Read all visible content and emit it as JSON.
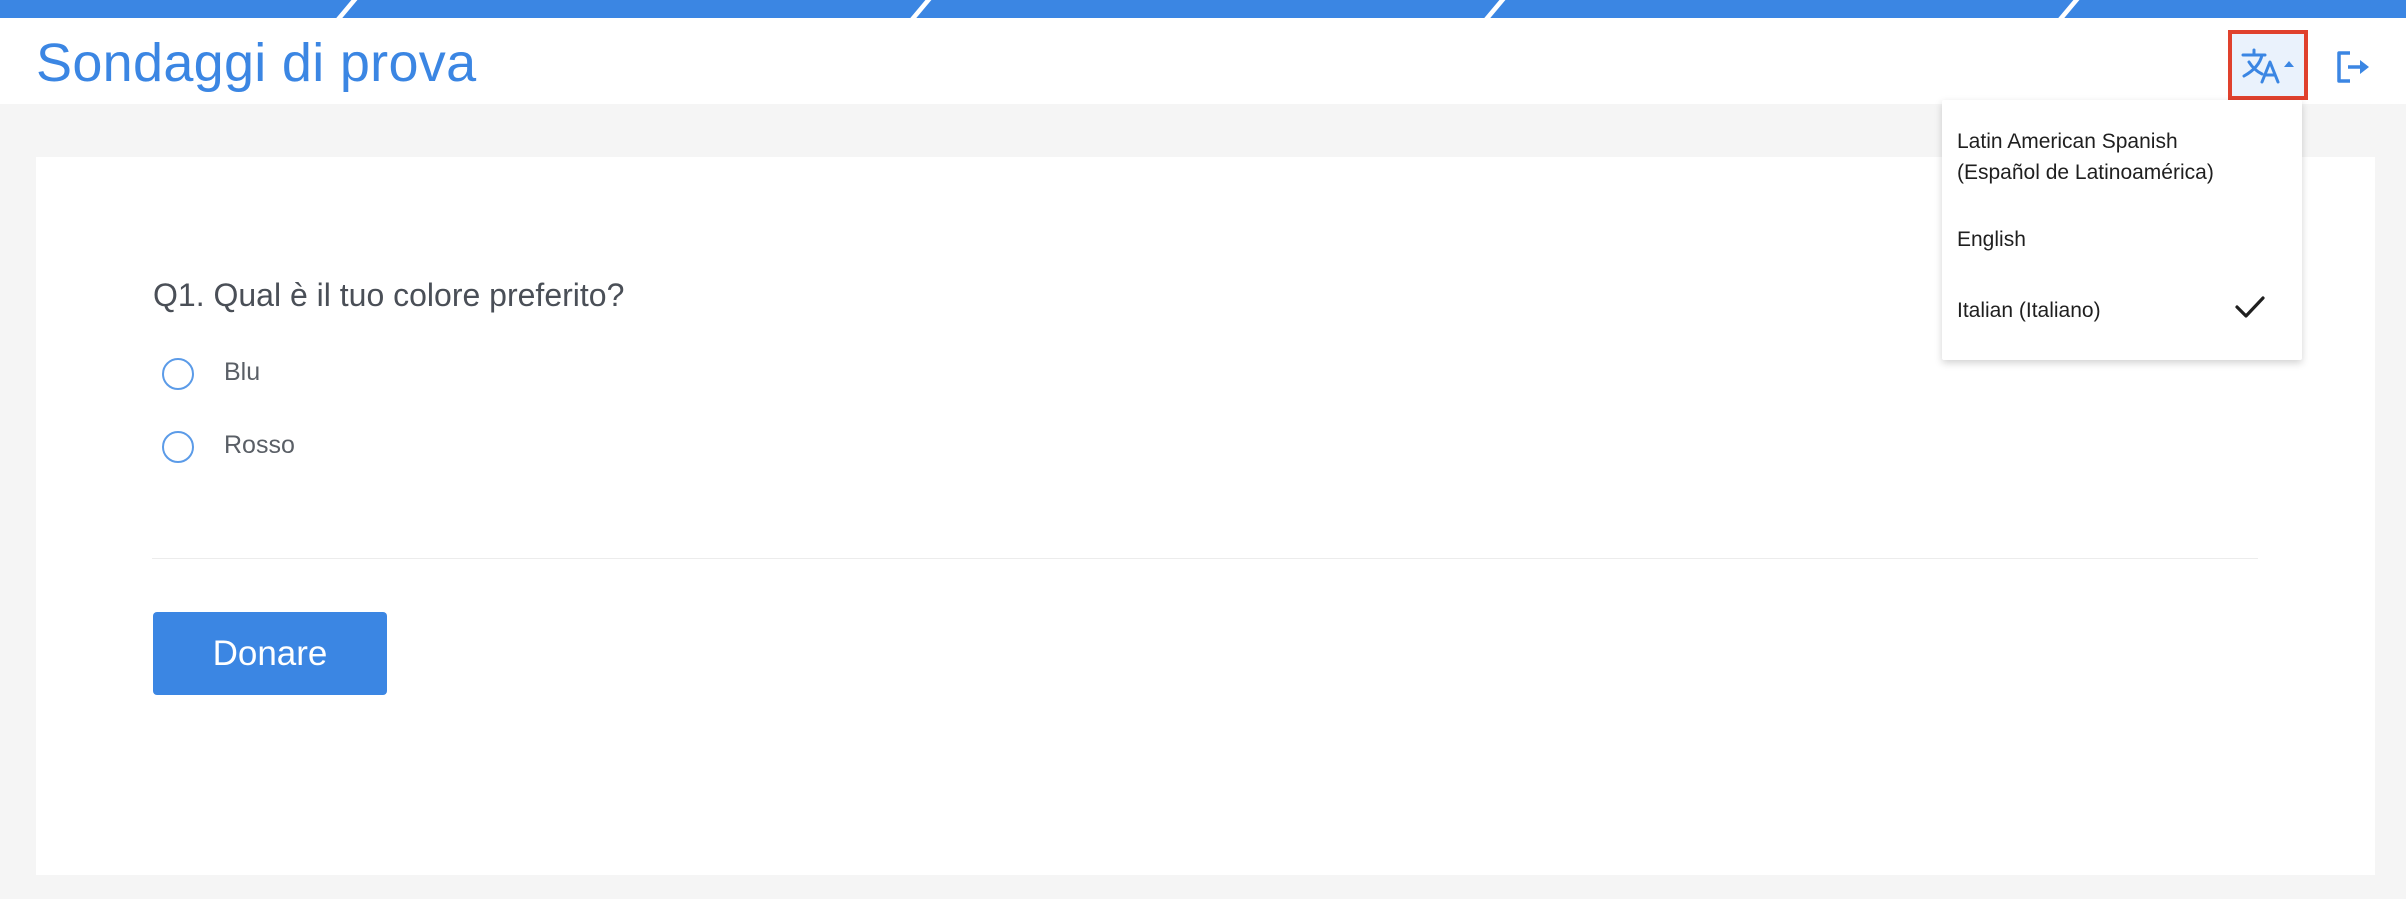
{
  "header": {
    "title": "Sondaggi di prova",
    "language_icon": "translate-icon",
    "logout_icon": "logout-icon"
  },
  "language_menu": {
    "items": [
      {
        "line1": "Latin American Spanish",
        "line2": "(Español de Latinoamérica)",
        "selected": false
      },
      {
        "line1": "English",
        "line2": "",
        "selected": false
      },
      {
        "line1": "Italian (Italiano)",
        "line2": "",
        "selected": true
      }
    ],
    "check_icon": "check-icon"
  },
  "survey": {
    "question": "Q1. Qual è il tuo colore preferito?",
    "options": [
      {
        "label": "Blu"
      },
      {
        "label": "Rosso"
      }
    ],
    "submit_label": "Donare"
  },
  "colors": {
    "accent": "#3b86e3",
    "highlight_border": "#e0412d",
    "background": "#f5f5f5"
  }
}
